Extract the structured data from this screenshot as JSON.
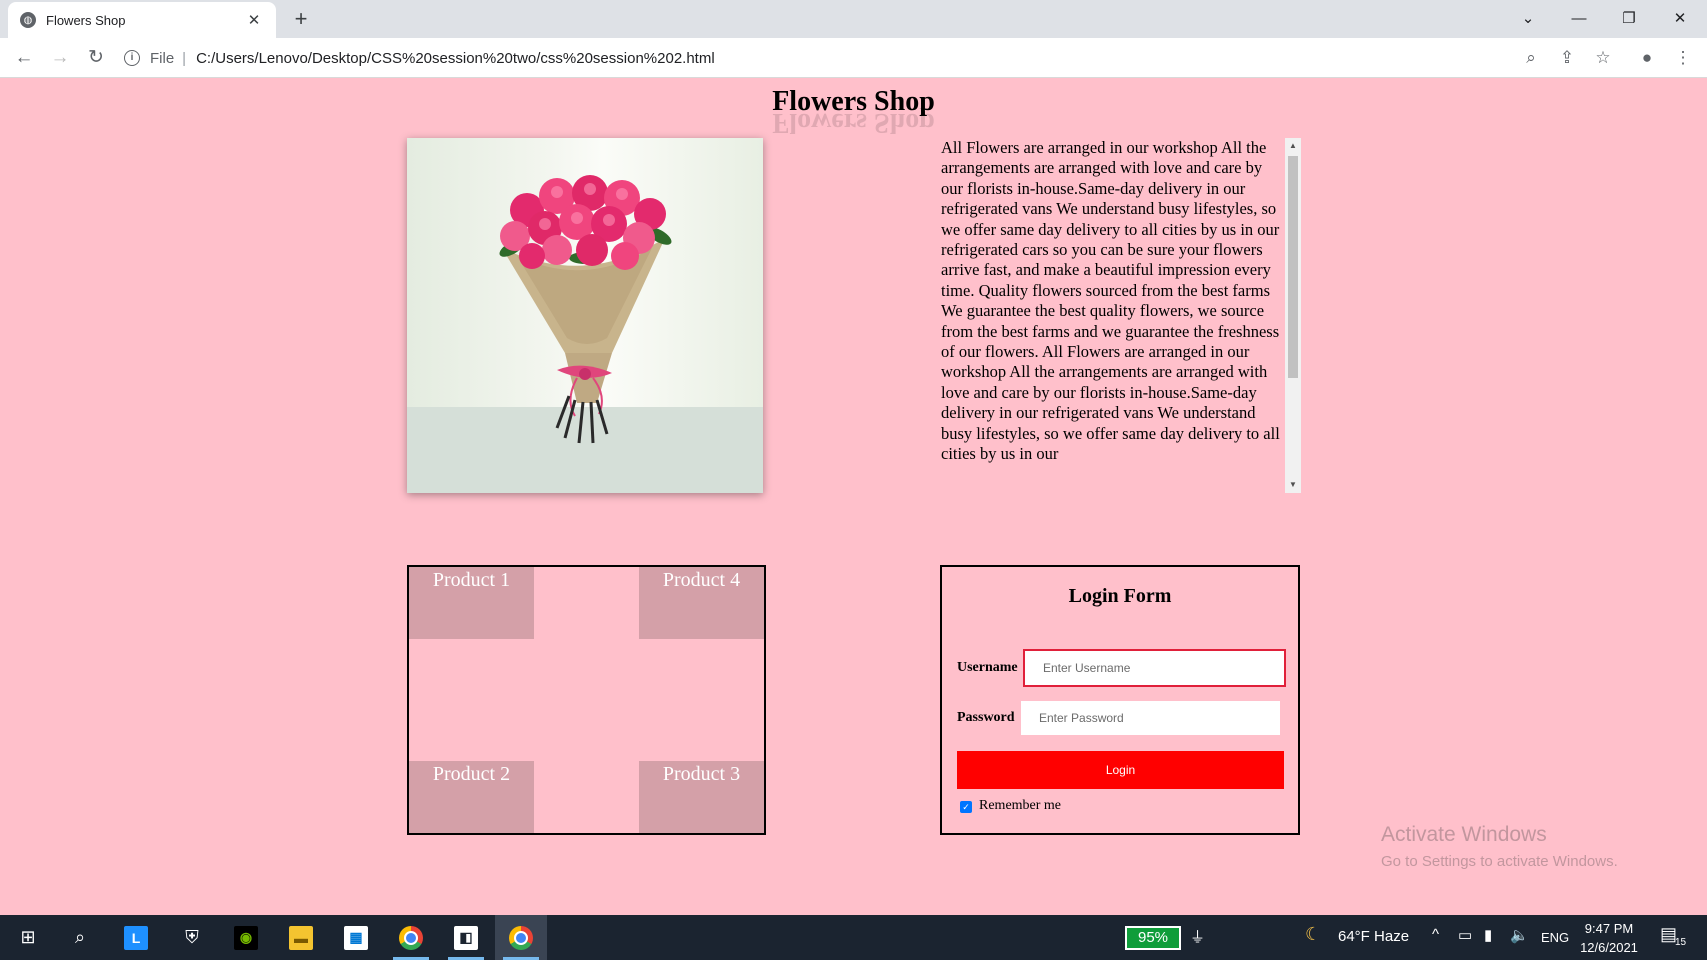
{
  "browser": {
    "tab_title": "Flowers Shop",
    "tab_close": "✕",
    "new_tab": "+",
    "url_scheme": "File",
    "url": "C:/Users/Lenovo/Desktop/CSS%20session%20two/css%20session%202.html"
  },
  "page": {
    "title": "Flowers Shop",
    "hero_image_alt": "Bouquet of pink roses wrapped in burlap",
    "description": "All Flowers are arranged in our workshop All the arrangements are arranged with love and care by our florists in-house.Same-day delivery in our refrigerated vans We understand busy lifestyles, so we offer same day delivery to all cities by us in our refrigerated cars so you can be sure your flowers arrive fast, and make a beautiful impression every time. Quality flowers sourced from the best farms We guarantee the best quality flowers, we source from the best farms and we guarantee the freshness of our flowers. All Flowers are arranged in our workshop All the arrangements are arranged with love and care by our florists in-house.Same-day delivery in our refrigerated vans We understand busy lifestyles, so we offer same day delivery to all cities by us in our"
  },
  "products": {
    "p1": "Product 1",
    "p2": "Product 2",
    "p3": "Product 3",
    "p4": "Product 4"
  },
  "login": {
    "title": "Login Form",
    "username_label": "Username",
    "username_placeholder": "Enter Username",
    "password_label": "Password",
    "password_placeholder": "Enter Password",
    "button": "Login",
    "remember": "Remember me",
    "remember_checked": true
  },
  "watermark": {
    "line1": "Activate Windows",
    "line2": "Go to Settings to activate Windows."
  },
  "taskbar": {
    "battery": "95%",
    "weather": "64°F  Haze",
    "language": "ENG",
    "time": "9:47 PM",
    "date": "12/6/2021",
    "notifications": "15"
  },
  "colors": {
    "page_background": "#ffc0cb",
    "product_box": "#d4a0a8",
    "login_button": "#ff0000",
    "taskbar": "#1b2430"
  }
}
